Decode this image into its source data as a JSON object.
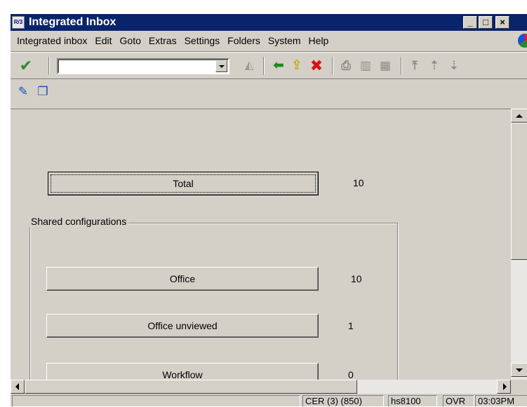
{
  "window": {
    "title": "Integrated Inbox",
    "title_icon_text": "R/3",
    "buttons": {
      "minimize": "_",
      "maximize": "□",
      "close": "×"
    }
  },
  "menubar": {
    "items": [
      "Integrated inbox",
      "Edit",
      "Goto",
      "Extras",
      "Settings",
      "Folders",
      "System",
      "Help"
    ]
  },
  "toolbar": {
    "command_field_value": "",
    "icons": [
      "enter-check-icon",
      "save-icon",
      "back-arrow-icon",
      "exit-up-icon",
      "cancel-x-icon",
      "print-icon",
      "find-icon",
      "find-next-icon",
      "first-page-icon",
      "previous-page-icon",
      "next-page-icon"
    ],
    "colors": {
      "check": "#2e8b2e",
      "back": "#1f8a1f",
      "exit": "#c9a400",
      "cancel": "#e01010"
    }
  },
  "app_toolbar": {
    "icons": [
      "edit-list-icon",
      "windows-icon"
    ]
  },
  "content": {
    "total": {
      "label": "Total",
      "count": "10"
    },
    "group_title": "Shared configurations",
    "folders": [
      {
        "label": "Office",
        "count": "10"
      },
      {
        "label": "Office unviewed",
        "count": "1"
      },
      {
        "label": "Workflow",
        "count": "0"
      }
    ]
  },
  "statusbar": {
    "system": "CER (3) (850)",
    "server": "hs8100",
    "mode": "OVR",
    "time": "03:03PM"
  }
}
